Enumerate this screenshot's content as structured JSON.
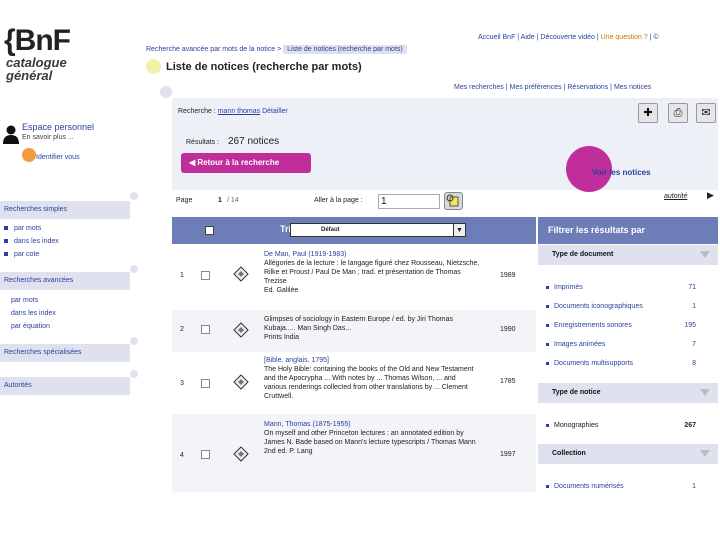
{
  "logo": {
    "brand": "{BnF",
    "subtitle": "catalogue général"
  },
  "topnav": {
    "accueil": "Accueil BnF",
    "aide": "Aide",
    "video": "Découverte vidéo",
    "question": "Une question ?",
    "extra": "©"
  },
  "breadcrumb": {
    "parent": "Recherche avancée par mots de la notice",
    "current": "Liste de notices (recherche par mots)"
  },
  "page_title": "Liste de notices (recherche par mots)",
  "sublinks": [
    "Mes recherches",
    "Mes préférences",
    "Réservations",
    "Mes notices"
  ],
  "sidebar": {
    "espace_title": "Espace personnel",
    "en_savoir": "En savoir plus ...",
    "identifier": "Identifier vous",
    "sections": [
      {
        "title": "Recherches simples",
        "items": [
          "par mots",
          "dans les index",
          "par cote"
        ]
      },
      {
        "title": "Recherches avancées",
        "items": [
          "par mots",
          "dans les index",
          "par équation"
        ]
      },
      {
        "title": "Recherches spécialisées",
        "items": []
      },
      {
        "title": "Autorités",
        "items": []
      }
    ]
  },
  "search": {
    "label": "Recherche :",
    "query": "mann thomas",
    "detail": "Détailler",
    "results_label": "Résultats :",
    "results_count": "267 notices",
    "retour": "Retour à la recherche",
    "voir_notices": "Voir les notices",
    "page_label": "Page",
    "page_current": "1",
    "page_total": "/ 14",
    "aller_label": "Aller à la page :",
    "aller_value": "1",
    "autorite_link": "autorité",
    "tri_label": "Tri",
    "tri_value": "Défaut"
  },
  "toolbar": {
    "add_icon": "add-notice-icon",
    "print_icon": "print-icon",
    "email_icon": "email-icon"
  },
  "results": [
    {
      "num": "1",
      "author": "De Man, Paul (1919-1983)",
      "text": "Allégories de la lecture : le langage figuré chez Rousseau, Nietzsche, Rilke et Proust / Paul De Man ; trad. et présentation de Thomas Trezise",
      "publisher": "Ed. Galilée",
      "year": "1989"
    },
    {
      "num": "2",
      "author": "",
      "text": "Glimpses of sociology in Eastern Europe / ed. by Jiri Thomas Kubaja..... Man Singh Das...",
      "publisher": "Prints India",
      "year": "1990"
    },
    {
      "num": "3",
      "author": "[Bible. anglais. 1795]",
      "text": "The Holy Bible: containing the books of the Old and New Testament and the Apocrypha ... With notes by ... Thomas Wilson, ... and various renderings collected from other translations by ... Clement Cruttwell.",
      "publisher": "",
      "year": "1785"
    },
    {
      "num": "4",
      "author": "Mann, Thomas (1875-1955)",
      "text": "On myself and other Princeton lectures : an annotated edition by James N. Bade based on Mann's lecture typescripts / Thomas Mann",
      "publisher": "2nd ed. P. Lang",
      "year": "1997"
    }
  ],
  "filters": {
    "title": "Filtrer les résultats par",
    "type_document": {
      "title": "Type de document",
      "items": [
        {
          "label": "Imprimés",
          "count": "71"
        },
        {
          "label": "Documents iconographiques",
          "count": "1"
        },
        {
          "label": "Enregistrements sonores",
          "count": "195"
        },
        {
          "label": "Images animées",
          "count": "7"
        },
        {
          "label": "Documents multisupports",
          "count": "8"
        }
      ]
    },
    "type_notice": {
      "title": "Type de notice",
      "items": [
        {
          "label": "Monographies",
          "count": "267"
        }
      ]
    },
    "collection": {
      "title": "Collection",
      "items": [
        {
          "label": "Documents numérisés",
          "count": "1"
        }
      ]
    }
  }
}
